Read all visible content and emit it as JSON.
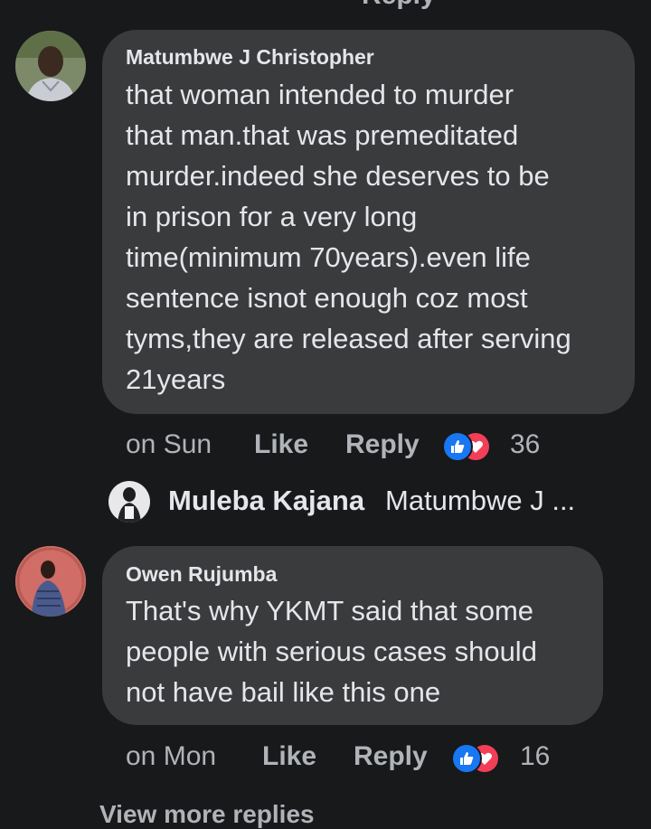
{
  "top_partial": {
    "label": "Reply"
  },
  "comments": [
    {
      "author": "Matumbwe J Christopher",
      "lines": [
        "that woman intended to murder",
        "that man.that was premeditated",
        "murder.indeed she deserves to be",
        "in prison for a very long",
        "time(minimum 70years).even life",
        "sentence isnot enough coz most",
        "tyms,they are released after serving",
        "21years"
      ],
      "time": "on Sun",
      "like_label": "Like",
      "reply_label": "Reply",
      "reaction_count": "36"
    },
    {
      "author": "Owen Rujumba",
      "lines": [
        "That's why YKMT said that some",
        "people with serious cases should",
        "not have bail like this one"
      ],
      "time": "on Mon",
      "like_label": "Like",
      "reply_label": "Reply",
      "reaction_count": "16"
    }
  ],
  "reply_preview": {
    "author": "Muleba Kajana",
    "snippet": "Matumbwe J ..."
  },
  "bottom_partial": {
    "label": "View more replies"
  },
  "icons": {
    "like": "thumbs-up-icon",
    "love": "heart-icon"
  },
  "colors": {
    "background": "#18191a",
    "bubble": "#3a3b3c",
    "text": "#e4e6eb",
    "muted": "#b0b3b8",
    "like_blue": "#1877f2",
    "love_red": "#f33e58"
  }
}
